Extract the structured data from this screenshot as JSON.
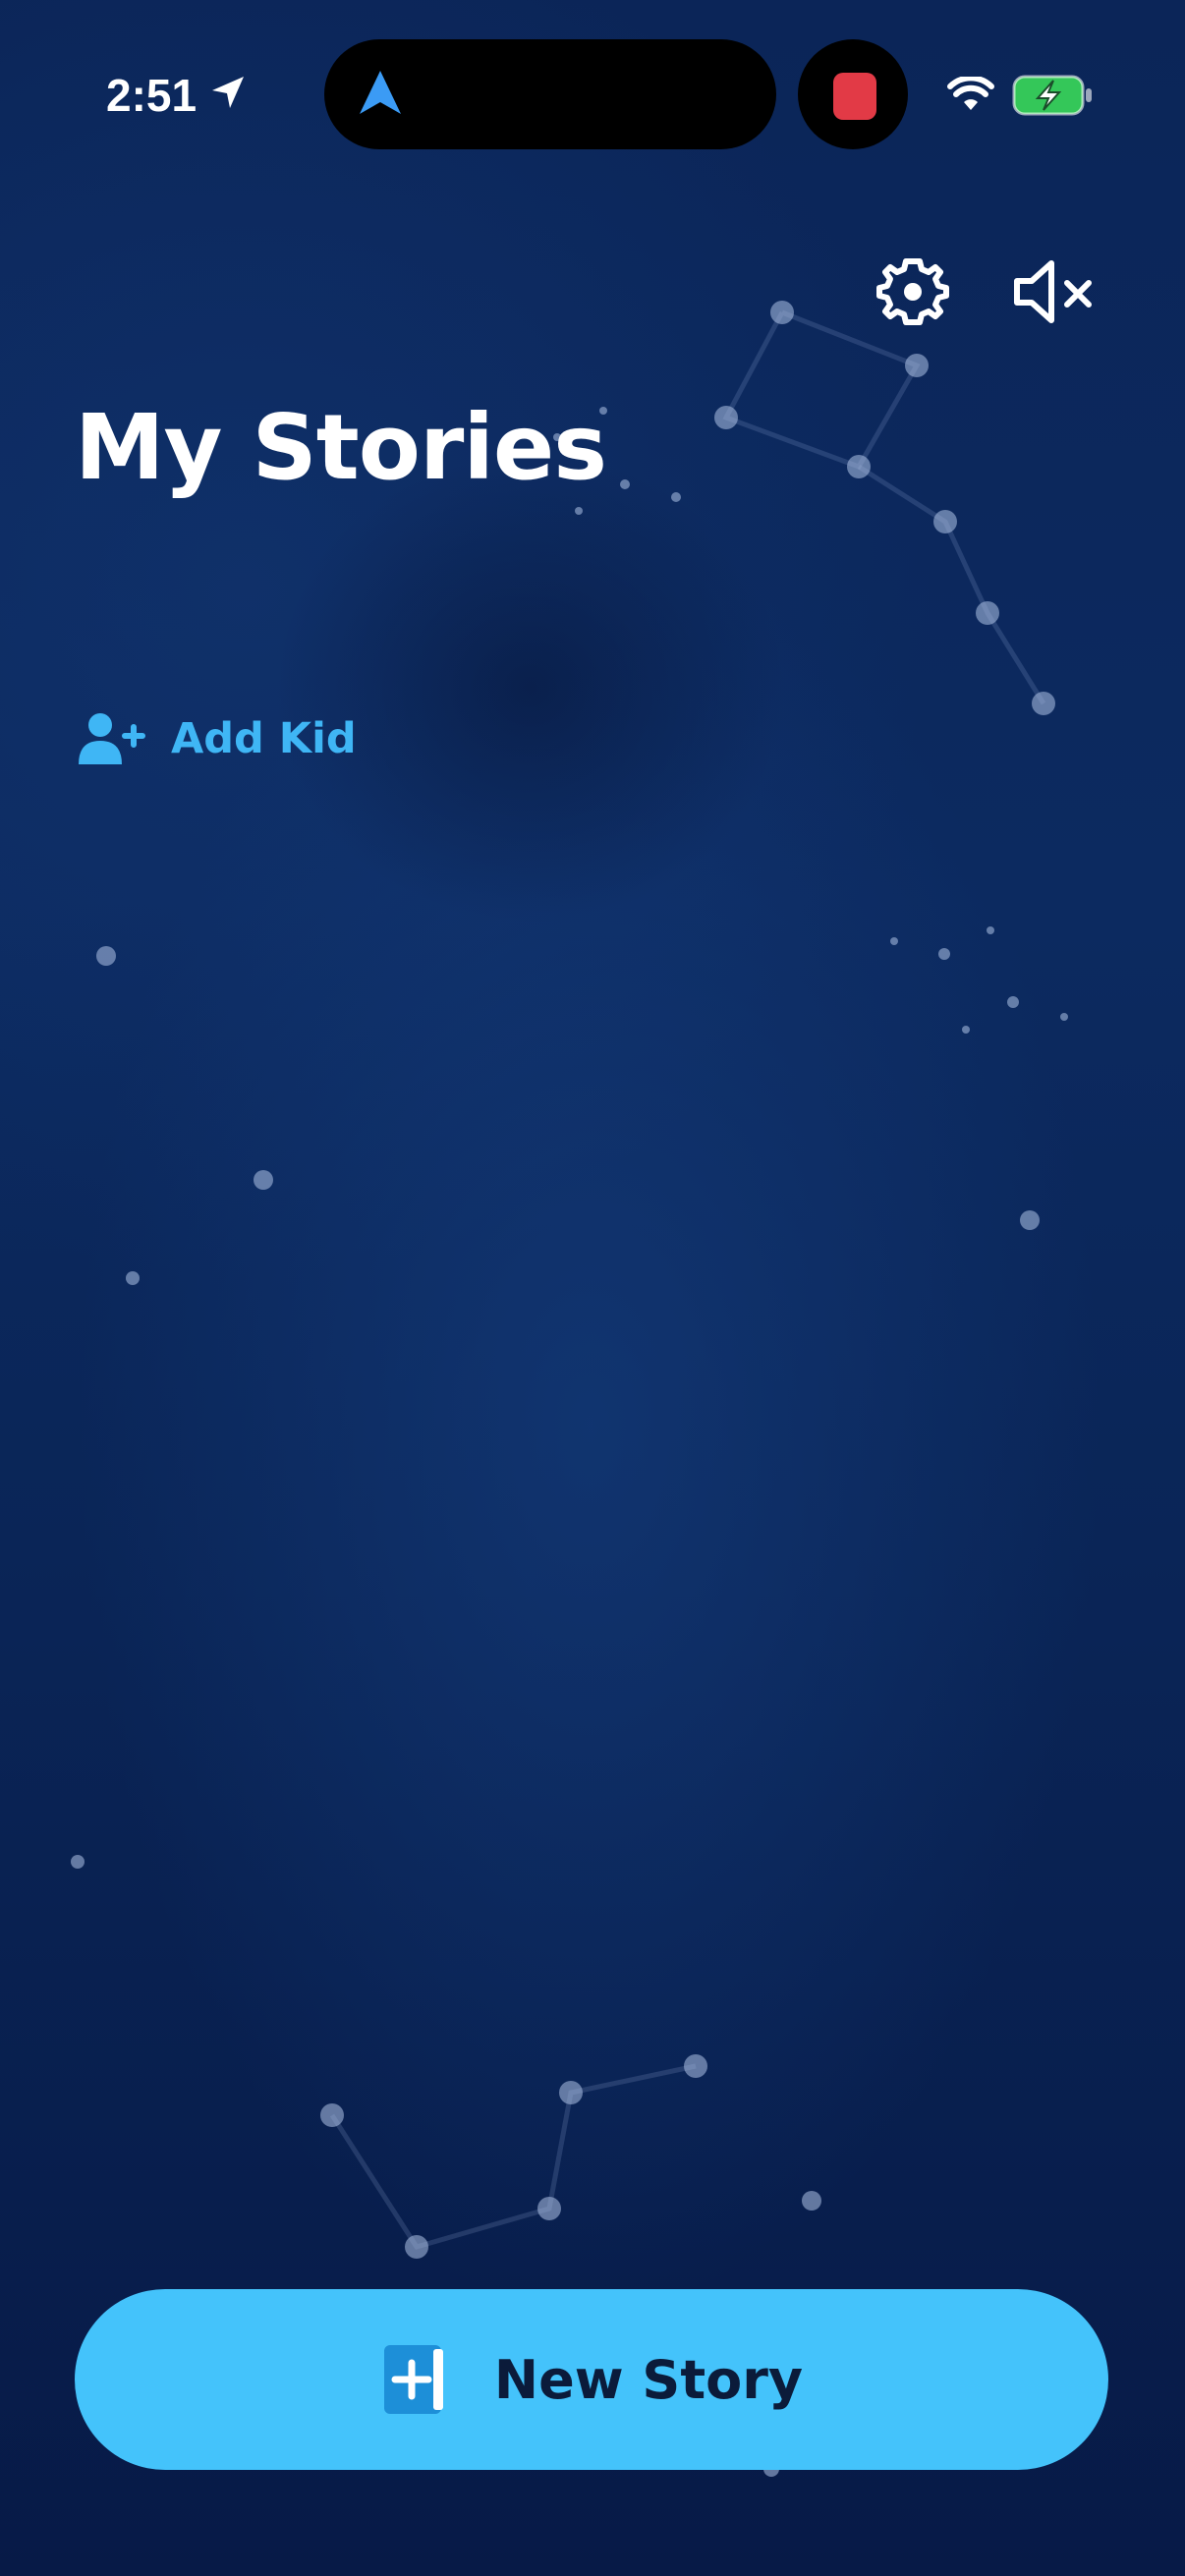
{
  "status_bar": {
    "time": "2:51",
    "icons": [
      "location-arrow-icon",
      "navigation-icon",
      "app-activity-icon",
      "wifi-icon",
      "battery-charging-icon"
    ]
  },
  "header": {
    "title": "My Stories",
    "settings_icon": "gear-icon",
    "sound_icon": "speaker-muted-icon"
  },
  "kids": {
    "add_label": "Add Kid",
    "add_icon": "user-plus-icon"
  },
  "footer": {
    "new_story_label": "New Story",
    "new_story_icon": "book-plus-icon"
  },
  "colors": {
    "background": "#0a2557",
    "accent": "#44c3fb",
    "link": "#3fb6f5",
    "button_text": "#0b1b3a"
  }
}
